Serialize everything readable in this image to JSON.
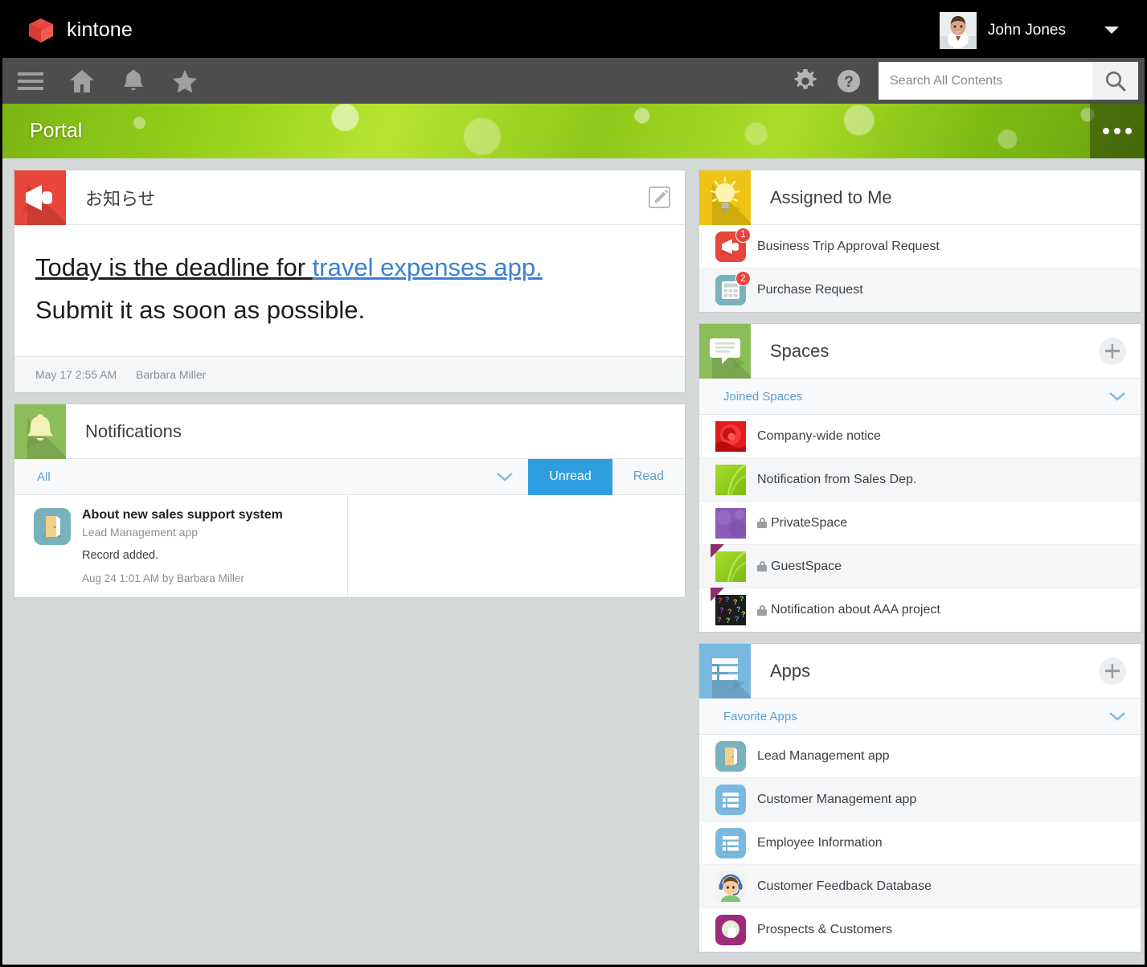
{
  "topbar": {
    "brand_name": "kintone",
    "brand_logo_icon": "kintone-cube-logo",
    "user_name": "John Jones",
    "avatar_icon": "user-avatar",
    "user_menu_icon": "chevron-down-icon"
  },
  "toolbar": {
    "menu_icon": "hamburger-menu-icon",
    "home_icon": "home-icon",
    "bell_icon": "bell-icon",
    "star_icon": "star-icon",
    "gear_icon": "gear-icon",
    "help_icon": "help-question-icon",
    "search_placeholder": "Search All Contents",
    "search_value": "",
    "search_button_icon": "search-icon"
  },
  "banner": {
    "title": "Portal",
    "menu_icon": "more-options-icon"
  },
  "announcement": {
    "header_icon": "megaphone-icon",
    "title": "お知らせ",
    "edit_icon": "edit-pencil-icon",
    "line1_prefix": "Today is the deadline for ",
    "line1_link": "travel expenses app.",
    "line2": "Submit it as soon as possible.",
    "timestamp": "May 17 2:55 AM",
    "author": "Barbara Miller"
  },
  "notifications": {
    "header_icon": "bell-icon",
    "title": "Notifications",
    "filter_all": "All",
    "filter_chevron_icon": "chevron-down-icon",
    "tab_unread": "Unread",
    "tab_read": "Read",
    "active_tab": "Unread",
    "items": [
      {
        "icon": "open-door-app-icon",
        "title": "About new sales support system",
        "app": "Lead Management app",
        "message": "Record added.",
        "meta": "Aug 24 1:01 AM  by Barbara Miller"
      }
    ]
  },
  "assigned_to_me": {
    "header_icon": "lightbulb-icon",
    "title": "Assigned to Me",
    "items": [
      {
        "icon": "megaphone-icon",
        "label": "Business Trip Approval Request",
        "badge": "1"
      },
      {
        "icon": "calculator-icon",
        "label": "Purchase Request",
        "badge": "2"
      }
    ]
  },
  "spaces": {
    "header_icon": "speech-bubble-icon",
    "title": "Spaces",
    "add_icon": "plus-icon",
    "section_label": "Joined Spaces",
    "section_chevron_icon": "chevron-down-icon",
    "items": [
      {
        "thumb": "red-rose-thumbnail",
        "label": "Company-wide notice",
        "locked": false,
        "guest": false
      },
      {
        "thumb": "green-leaf-thumbnail",
        "label": "Notification from Sales Dep.",
        "locked": false,
        "guest": false
      },
      {
        "thumb": "purple-texture-thumbnail",
        "label": "PrivateSpace",
        "locked": true,
        "guest": false
      },
      {
        "thumb": "green-leaf-thumbnail",
        "label": "GuestSpace",
        "locked": true,
        "guest": true
      },
      {
        "thumb": "dark-question-marks-thumbnail",
        "label": "Notification about AAA project",
        "locked": true,
        "guest": true
      }
    ]
  },
  "apps": {
    "header_icon": "list-icon",
    "title": "Apps",
    "add_icon": "plus-icon",
    "section_label": "Favorite Apps",
    "section_chevron_icon": "chevron-down-icon",
    "items": [
      {
        "icon": "open-door-app-icon",
        "label": "Lead Management app"
      },
      {
        "icon": "list-app-icon",
        "label": "Customer Management app"
      },
      {
        "icon": "list-app-icon",
        "label": "Employee Information"
      },
      {
        "icon": "headset-person-icon",
        "label": "Customer Feedback Database"
      },
      {
        "icon": "purple-hand-icon",
        "label": "Prospects & Customers"
      }
    ]
  },
  "colors": {
    "brand_red": "#e8453c",
    "accent_blue": "#2f9ee0",
    "link_blue": "#3b7fd4",
    "topbar_black": "#000000",
    "toolbar_gray": "#4d4d4d",
    "page_background": "#d4d8d9",
    "banner_green": "#8fc81b"
  }
}
